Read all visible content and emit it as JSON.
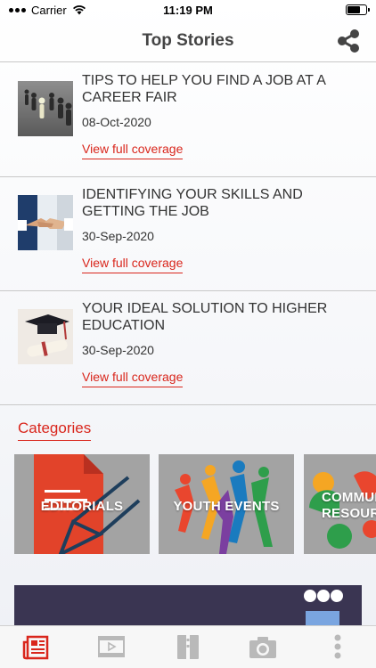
{
  "status_bar": {
    "carrier": "Carrier",
    "time": "11:19 PM",
    "battery_level": 0.75
  },
  "header": {
    "title": "Top Stories",
    "share_icon": "share-icon"
  },
  "stories": [
    {
      "title": "TIPS TO HELP YOU FIND A JOB AT A CAREER FAIR",
      "date": "08-Oct-2020",
      "link": "View full coverage",
      "thumb": "career-fair-thumbnail"
    },
    {
      "title": "IDENTIFYING YOUR SKILLS AND GETTING THE JOB",
      "date": "30-Sep-2020",
      "link": "View full coverage",
      "thumb": "handshake-thumbnail"
    },
    {
      "title": "YOUR IDEAL SOLUTION TO HIGHER EDUCATION",
      "date": "30-Sep-2020",
      "link": "View full coverage",
      "thumb": "graduation-thumbnail"
    }
  ],
  "categories": {
    "heading": "Categories",
    "items": [
      {
        "label": "EDITORIALS"
      },
      {
        "label": "YOUTH EVENTS"
      },
      {
        "label": "COMMUNITY RESOURCES"
      }
    ]
  },
  "tab_bar": {
    "tabs": [
      {
        "icon": "newspaper-icon",
        "active": true
      },
      {
        "icon": "video-icon",
        "active": false
      },
      {
        "icon": "book-icon",
        "active": false
      },
      {
        "icon": "camera-icon",
        "active": false
      },
      {
        "icon": "more-icon",
        "active": false
      }
    ]
  },
  "colors": {
    "accent": "#d9261c",
    "divider": "#c8c8c8",
    "inactive_tab": "#b9b9b9"
  }
}
